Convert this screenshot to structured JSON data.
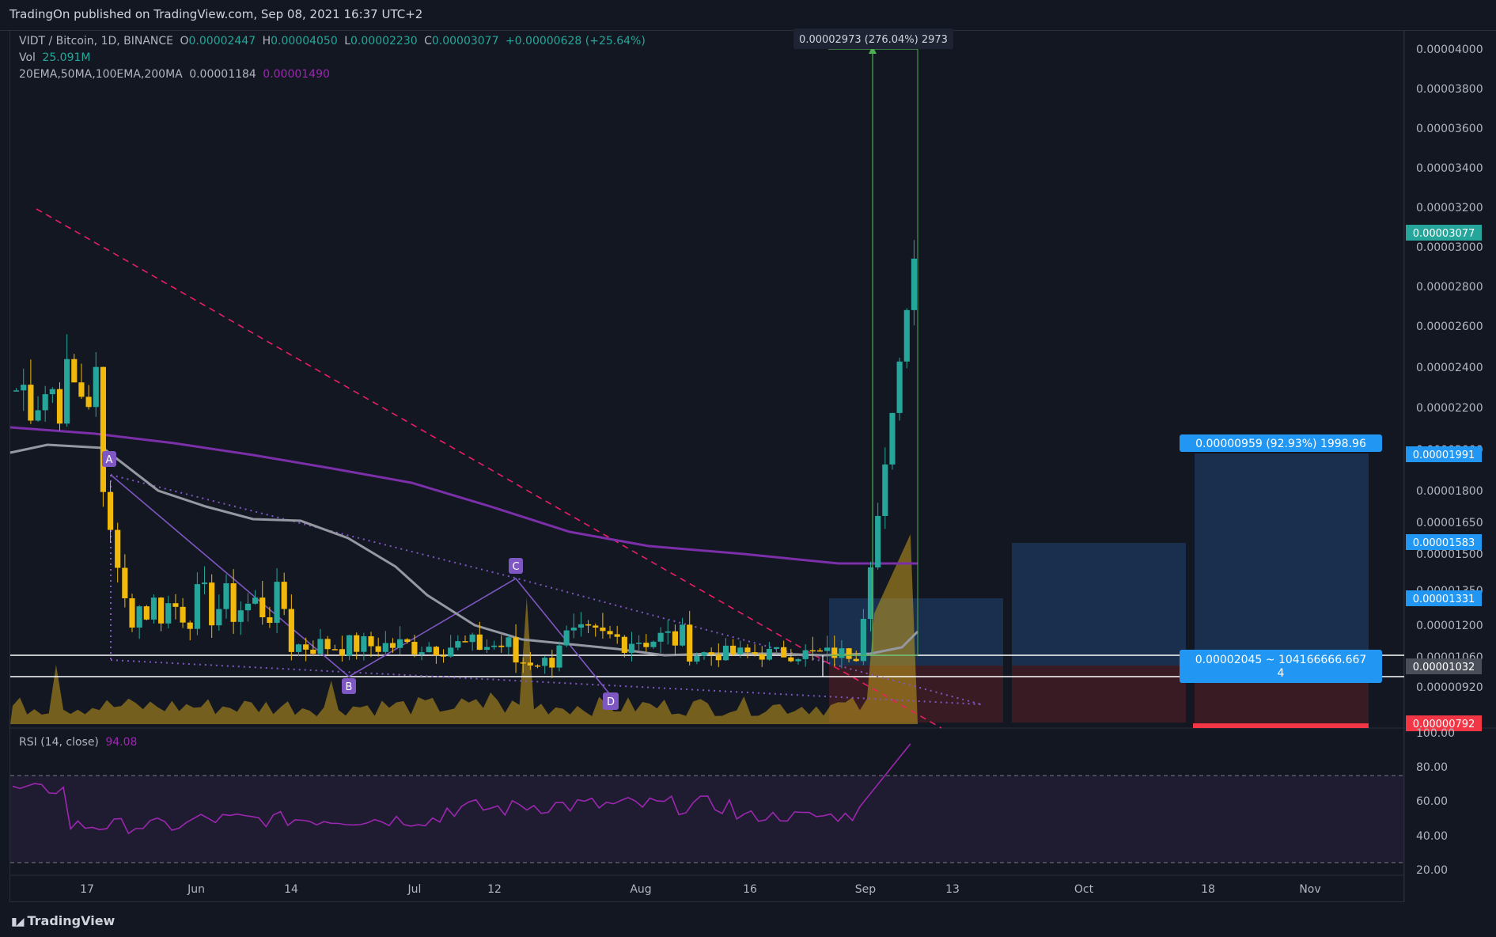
{
  "header": {
    "published": "TradingOn published on TradingView.com, Sep 08, 2021 16:37 UTC+2"
  },
  "legend": {
    "symbol": "VIDT / Bitcoin, 1D, BINANCE",
    "open_label": "O",
    "open": "0.00002447",
    "high_label": "H",
    "high": "0.00004050",
    "low_label": "L",
    "low": "0.00002230",
    "close_label": "C",
    "close": "0.00003077",
    "change": "+0.00000628 (+25.64%)",
    "vol_label": "Vol",
    "vol": "25.091M",
    "ma_label": "20EMA,50MA,100EMA,200MA",
    "ma_val1": "0.00001184",
    "ma_val2": "0.00001490",
    "rsi_label": "RSI (14, close)",
    "rsi_val": "94.08"
  },
  "annotations": {
    "measure_top": "0.00002973 (276.04%) 2973",
    "target_label": "0.00000959 (92.93%) 1998.96",
    "range_label_1": "0.00002045 ~ 104166666.667",
    "range_label_2": "4"
  },
  "badges": {
    "last": "0.00003077",
    "target": "0.00001991",
    "t2": "0.00001583",
    "t1": "0.00001331",
    "entry": "0.00001032",
    "stop": "0.00000792"
  },
  "footer": {
    "brand": "TradingView"
  },
  "colors": {
    "bg": "#131722",
    "up": "#26a69a",
    "down": "#f0b90b",
    "ma200": "#7b2fa8",
    "ma50": "#9598a1",
    "trend": "#e91e63",
    "pattern": "#7e57c2"
  },
  "chart_data": {
    "type": "candlestick",
    "title": "VIDT / Bitcoin, 1D, BINANCE",
    "price_ticks": [
      "0.00004000",
      "0.00003800",
      "0.00003600",
      "0.00003400",
      "0.00003200",
      "0.00003000",
      "0.00002800",
      "0.00002600",
      "0.00002400",
      "0.00002200",
      "0.00002000",
      "0.00001800",
      "0.00001650",
      "0.00001500",
      "0.00001350",
      "0.00001200",
      "0.00001060",
      "0.00000920"
    ],
    "time_ticks": [
      "17",
      "Jun",
      "14",
      "Jul",
      "12",
      "Aug",
      "16",
      "Sep",
      "13",
      "Oct",
      "18",
      "Nov"
    ],
    "rsi_ticks": [
      "100.00",
      "80.00",
      "60.00",
      "40.00",
      "20.00"
    ],
    "pattern_points": [
      "A",
      "B",
      "C",
      "D"
    ],
    "price_range": [
      7.9e-06,
      4.14e-05
    ],
    "rsi_range": [
      15,
      102
    ],
    "rsi_overbought": 75,
    "rsi_oversold": 25,
    "levels": {
      "entry": 1.032e-05,
      "horizontal_2": 9.75e-06,
      "target": 1.991e-05,
      "t2": 1.583e-05,
      "t1": 1.331e-05,
      "stop": 7.92e-06
    }
  }
}
